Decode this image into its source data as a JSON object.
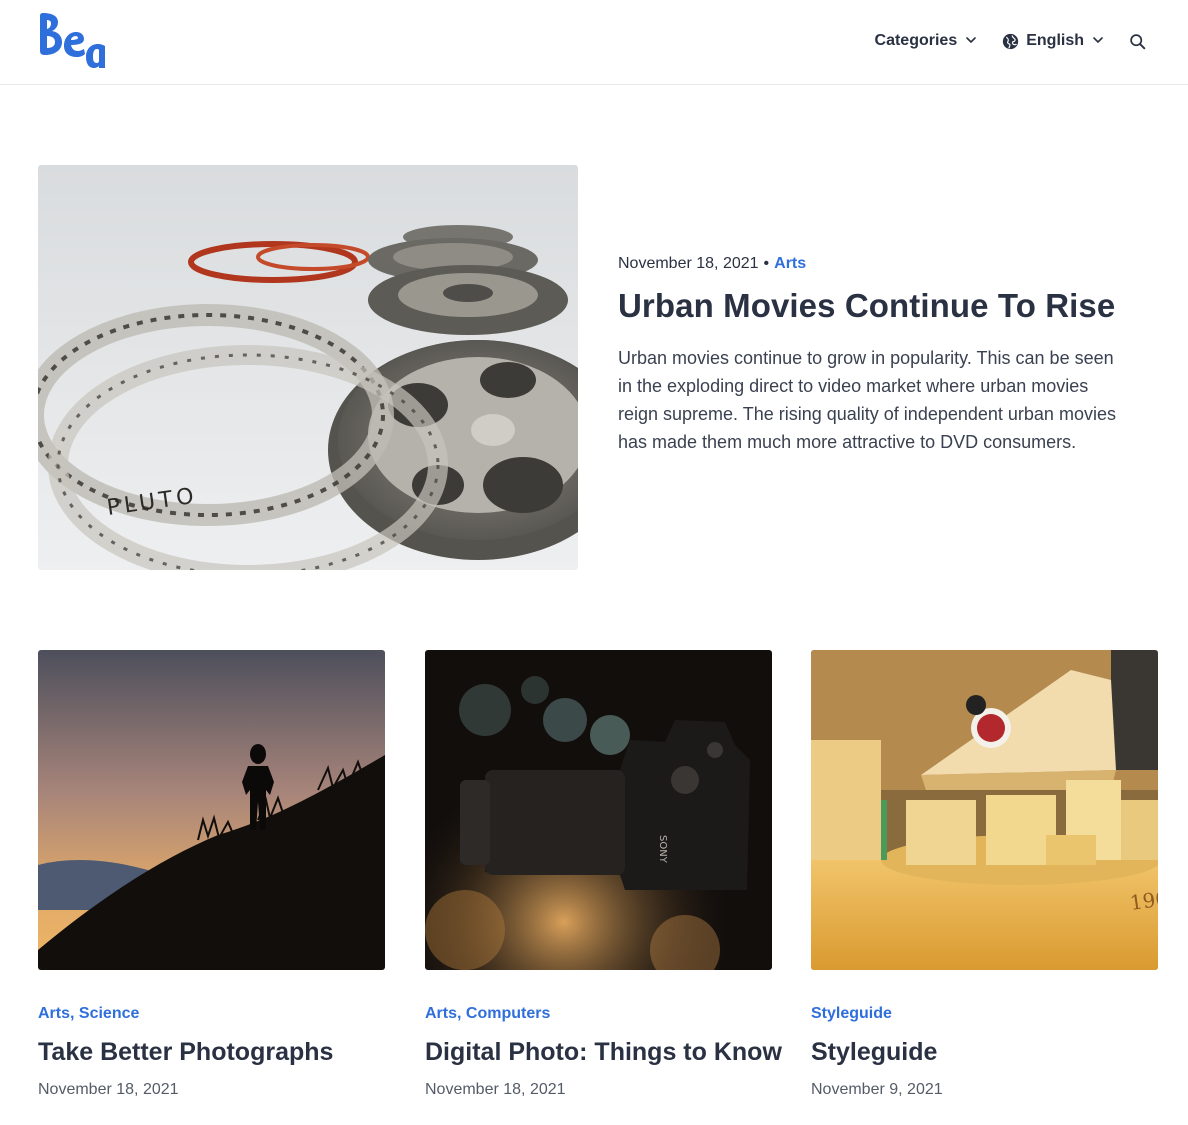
{
  "header": {
    "logo_text": "Bea",
    "nav": {
      "categories_label": "Categories",
      "language_label": "English"
    }
  },
  "hero": {
    "date": "November 18, 2021",
    "separator": "•",
    "category": "Arts",
    "title": "Urban Movies Continue To Rise",
    "excerpt": "Urban movies continue to grow in popularity. This can be seen in the exploding direct to video market where urban movies reign supreme. The rising quality of independent urban movies has made them much more attractive to DVD consumers."
  },
  "posts": [
    {
      "categories": "Arts, Science",
      "title": "Take Better Photographs",
      "date": "November 18, 2021"
    },
    {
      "categories": "Arts, Computers",
      "title": "Digital Photo: Things to Know",
      "date": "November 18, 2021"
    },
    {
      "categories": "Styleguide",
      "title": "Styleguide",
      "date": "November 9, 2021"
    }
  ],
  "colors": {
    "accent": "#2f6fdc",
    "text": "#2a3142",
    "border": "#e6e8ec"
  }
}
